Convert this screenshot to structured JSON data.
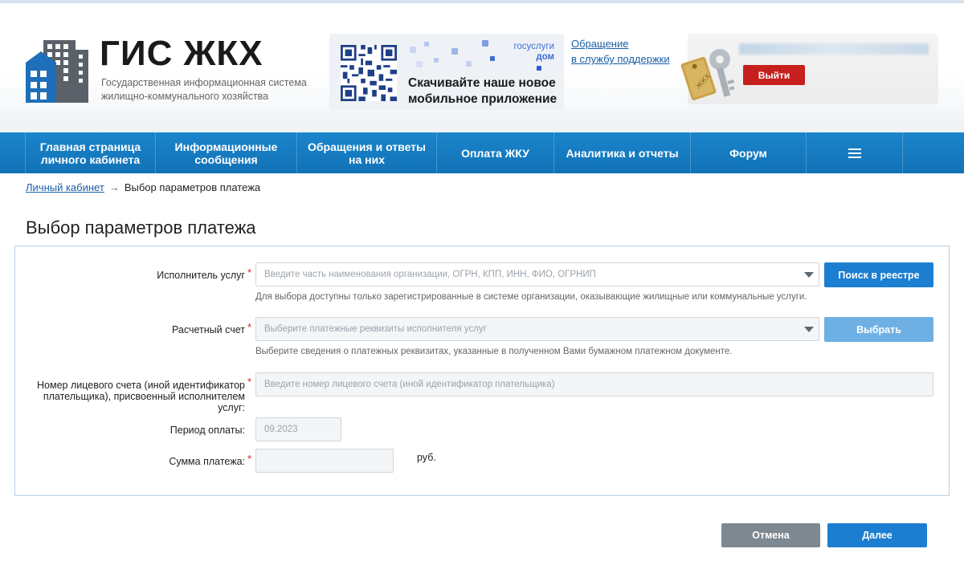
{
  "header": {
    "title": "ГИС ЖКХ",
    "subtitle": "Государственная информационная система жилищно-коммунального хозяйства",
    "promo": {
      "brand_line1": "госуслуги",
      "brand_line2": "дом",
      "text": "Скачивайте наше новое мобильное приложение"
    },
    "support_line1": "Обращение",
    "support_line2": "в службу поддержки",
    "logout_label": "Выйти"
  },
  "nav": {
    "items": [
      {
        "label": "Главная страница личного кабинета"
      },
      {
        "label": "Информационные сообщения"
      },
      {
        "label": "Обращения и ответы на них"
      },
      {
        "label": "Оплата ЖКУ"
      },
      {
        "label": "Аналитика и отчеты"
      },
      {
        "label": "Форум"
      }
    ],
    "menu_icon": "hamburger-icon"
  },
  "breadcrumb": {
    "home": "Личный кабинет",
    "separator": "→",
    "current": "Выбор параметров платежа"
  },
  "page": {
    "title": "Выбор параметров платежа"
  },
  "form": {
    "provider": {
      "label": "Исполнитель услуг",
      "placeholder": "Введите часть наименования организации, ОГРН, КПП, ИНН, ФИО, ОГРНИП",
      "hint": "Для выбора доступны только зарегистрированные в системе организации, оказывающие жилищные или коммунальные услуги.",
      "button": "Поиск в реестре"
    },
    "account": {
      "label": "Расчетный счет",
      "placeholder": "Выберите платежные реквизиты исполнителя услуг",
      "hint": "Выберите сведения о платежных реквизитах, указанные в полученном Вами бумажном платежном документе.",
      "button": "Выбрать"
    },
    "personal_account": {
      "label_line1": "Номер лицевого счета (иной идентификатор",
      "label_line2": "плательщика), присвоенный исполнителем",
      "label_line3": "услуг:",
      "placeholder": "Введите номер лицевого счета (иной идентификатор плательщика)"
    },
    "period": {
      "label": "Период оплаты:",
      "value": "09.2023"
    },
    "amount": {
      "label": "Сумма платежа:",
      "value": "",
      "unit": "руб."
    },
    "required_mark": "*"
  },
  "actions": {
    "cancel": "Отмена",
    "next": "Далее"
  },
  "colors": {
    "nav_blue": "#1272b6",
    "primary_button": "#1c7ed0",
    "logout_red": "#c71e1e",
    "cancel_gray": "#7d8891",
    "link": "#1a5fa8"
  }
}
